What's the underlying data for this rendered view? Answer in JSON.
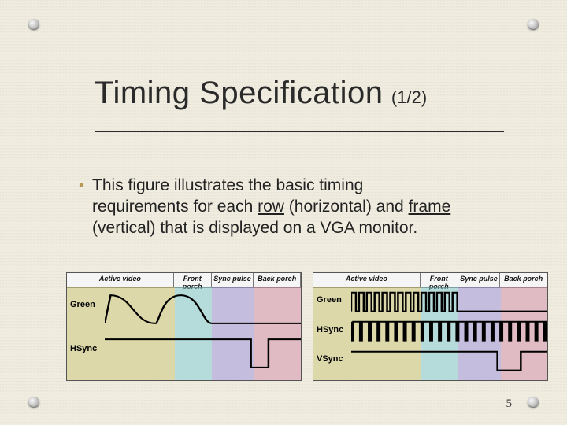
{
  "title": {
    "main": "Timing Specification",
    "sub": "(1/2)"
  },
  "bullet": {
    "pre": "This figure illustrates the basic timing requirements for each ",
    "row": "row",
    "mid1": " (horizontal)  and ",
    "frame": "frame",
    "post": " (vertical) that is displayed on a VGA monitor."
  },
  "segments": {
    "labels": [
      "Active video",
      "Front porch",
      "Sync pulse",
      "Back porch"
    ],
    "colors": [
      "#c7c06a",
      "#7fc7c2",
      "#9a8ec8",
      "#d08a9a"
    ]
  },
  "left_fig": {
    "signals": [
      "Green",
      "HSync"
    ],
    "seg_widths_pct": [
      46,
      16,
      18,
      20
    ]
  },
  "right_fig": {
    "signals": [
      "Green",
      "HSync",
      "VSync"
    ],
    "seg_widths_pct": [
      46,
      16,
      18,
      20
    ]
  },
  "page_number": "5"
}
